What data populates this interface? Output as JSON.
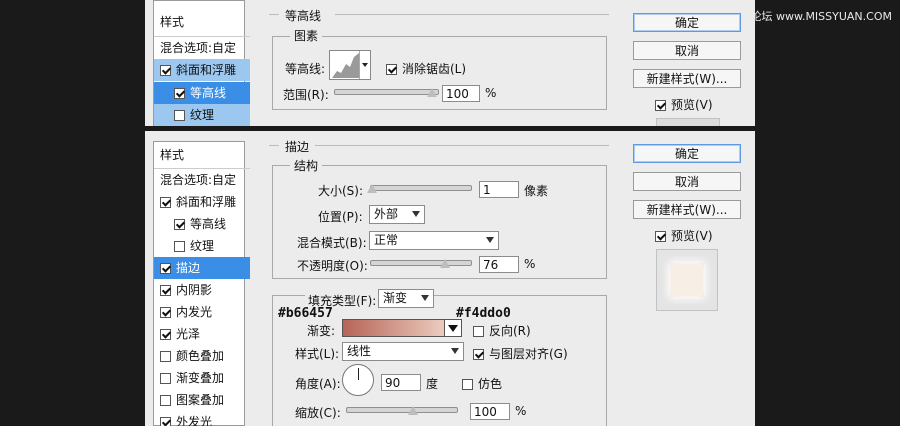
{
  "watermark": "思缘设计论坛 www.MISSYUAN.COM",
  "top": {
    "sidebar": {
      "items": [
        {
          "label": "样式"
        },
        {
          "label": "混合选项:自定"
        },
        {
          "label": "斜面和浮雕",
          "checked": true
        },
        {
          "label": "等高线",
          "checked": true
        },
        {
          "label": "纹理",
          "checked": false
        }
      ]
    },
    "section_title": "等高线",
    "group_title": "图素",
    "contour_label": "等高线:",
    "antialias_label": "消除锯齿(L)",
    "range_label": "范围(R):",
    "range_value": "100",
    "range_unit": "%",
    "buttons": {
      "ok": "确定",
      "cancel": "取消",
      "new_style": "新建样式(W)...",
      "preview": "预览(V)"
    }
  },
  "bottom": {
    "sidebar": {
      "items": [
        {
          "label": "样式"
        },
        {
          "label": "混合选项:自定"
        },
        {
          "label": "斜面和浮雕",
          "checked": true
        },
        {
          "label": "等高线",
          "checked": true
        },
        {
          "label": "纹理",
          "checked": false
        },
        {
          "label": "描边",
          "checked": true
        },
        {
          "label": "内阴影",
          "checked": true
        },
        {
          "label": "内发光",
          "checked": true
        },
        {
          "label": "光泽",
          "checked": true
        },
        {
          "label": "颜色叠加",
          "checked": false
        },
        {
          "label": "渐变叠加",
          "checked": false
        },
        {
          "label": "图案叠加",
          "checked": false
        },
        {
          "label": "外发光",
          "checked": true
        }
      ]
    },
    "section_title": "描边",
    "structure": {
      "title": "结构",
      "size_label": "大小(S):",
      "size_value": "1",
      "size_unit": "像素",
      "position_label": "位置(P):",
      "position_value": "外部",
      "blend_label": "混合模式(B):",
      "blend_value": "正常",
      "opacity_label": "不透明度(O):",
      "opacity_value": "76",
      "opacity_unit": "%"
    },
    "fill": {
      "type_label": "填充类型(F):",
      "type_value": "渐变",
      "gradient_label": "渐变:",
      "gradient_start": "#b66457",
      "gradient_end": "#f4ddd0",
      "reverse_label": "反向(R)",
      "style_label": "样式(L):",
      "style_value": "线性",
      "align_label": "与图层对齐(G)",
      "angle_label": "角度(A):",
      "angle_value": "90",
      "angle_unit": "度",
      "dither_label": "仿色",
      "scale_label": "缩放(C):",
      "scale_value": "100",
      "scale_unit": "%"
    },
    "annotations": {
      "left_hex": "#b66457",
      "right_hex": "#f4ddo0"
    },
    "buttons": {
      "ok": "确定",
      "cancel": "取消",
      "new_style": "新建样式(W)...",
      "preview": "预览(V)"
    }
  }
}
